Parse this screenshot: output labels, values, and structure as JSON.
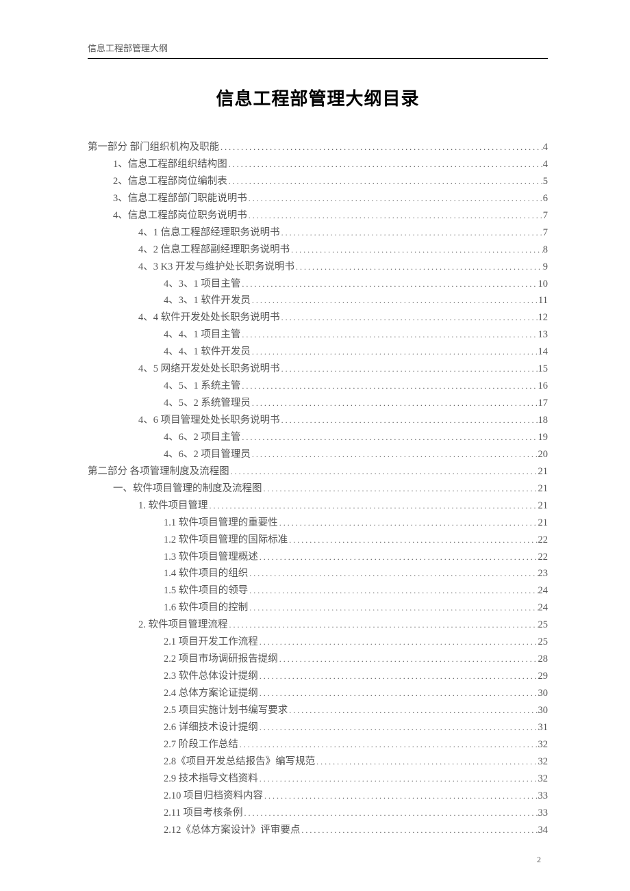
{
  "header": "信息工程部管理大纲",
  "title": "信息工程部管理大纲目录",
  "pageNumber": "2",
  "toc": [
    {
      "label": "第一部分 部门组织机构及职能",
      "page": "4",
      "level": 0
    },
    {
      "label": "1、信息工程部组织结构图",
      "page": "4",
      "level": 1
    },
    {
      "label": "2、信息工程部岗位编制表",
      "page": "5",
      "level": 1
    },
    {
      "label": "3、信息工程部部门职能说明书",
      "page": "6",
      "level": 1
    },
    {
      "label": "4、信息工程部岗位职务说明书",
      "page": "7",
      "level": 1
    },
    {
      "label": "4、1 信息工程部经理职务说明书",
      "page": "7",
      "level": 2
    },
    {
      "label": "4、2 信息工程部副经理职务说明书",
      "page": "8",
      "level": 2
    },
    {
      "label": "4、3 K3 开发与维护处长职务说明书",
      "page": "9",
      "level": 2
    },
    {
      "label": "4、3、1 项目主管",
      "page": "10",
      "level": 3
    },
    {
      "label": "4、3、1 软件开发员",
      "page": "11",
      "level": 3
    },
    {
      "label": "4、4 软件开发处处长职务说明书",
      "page": "12",
      "level": 2
    },
    {
      "label": "4、4、1  项目主管",
      "page": "13",
      "level": 3
    },
    {
      "label": "4、4、1  软件开发员",
      "page": "14",
      "level": 3
    },
    {
      "label": "4、5 网络开发处处长职务说明书",
      "page": "15",
      "level": 2
    },
    {
      "label": "4、5、1  系统主管",
      "page": "16",
      "level": 3
    },
    {
      "label": "4、5、2  系统管理员",
      "page": "17",
      "level": 3
    },
    {
      "label": "4、6 项目管理处处长职务说明书",
      "page": "18",
      "level": 2
    },
    {
      "label": "4、6、2  项目主管",
      "page": "19",
      "level": 3
    },
    {
      "label": "4、6、2  项目管理员",
      "page": "20",
      "level": 3
    },
    {
      "label": "第二部分 各项管理制度及流程图",
      "page": "21",
      "level": 0
    },
    {
      "label": "一、软件项目管理的制度及流程图",
      "page": "21",
      "level": 1
    },
    {
      "label": "1.  软件项目管理",
      "page": "21",
      "level": 2
    },
    {
      "label": "1.1 软件项目管理的重要性",
      "page": "21",
      "level": 3
    },
    {
      "label": "1.2 软件项目管理的国际标准",
      "page": "22",
      "level": 3
    },
    {
      "label": "1.3 软件项目管理概述",
      "page": "22",
      "level": 3
    },
    {
      "label": "1.4 软件项目的组织",
      "page": "23",
      "level": 3
    },
    {
      "label": "1.5 软件项目的领导",
      "page": "24",
      "level": 3
    },
    {
      "label": "1.6 软件项目的控制",
      "page": "24",
      "level": 3
    },
    {
      "label": "2.  软件项目管理流程",
      "page": "25",
      "level": 2
    },
    {
      "label": "2.1  项目开发工作流程",
      "page": "25",
      "level": 3
    },
    {
      "label": "2.2  项目市场调研报告提纲",
      "page": "28",
      "level": 3
    },
    {
      "label": "2.3  软件总体设计提纲",
      "page": "29",
      "level": 3
    },
    {
      "label": "2.4  总体方案论证提纲",
      "page": "30",
      "level": 3
    },
    {
      "label": "2.5  项目实施计划书编写要求",
      "page": "30",
      "level": 3
    },
    {
      "label": "2.6  详细技术设计提纲",
      "page": "31",
      "level": 3
    },
    {
      "label": "2.7  阶段工作总结",
      "page": "32",
      "level": 3
    },
    {
      "label": "2.8《项目开发总结报告》编写规范",
      "page": "32",
      "level": 3
    },
    {
      "label": "2.9  技术指导文档资料",
      "page": "32",
      "level": 3
    },
    {
      "label": "2.10  项目归档资料内容",
      "page": "33",
      "level": 3
    },
    {
      "label": "2.11  项目考核条例",
      "page": "33",
      "level": 3
    },
    {
      "label": "2.12《总体方案设计》评审要点",
      "page": "34",
      "level": 3
    }
  ]
}
